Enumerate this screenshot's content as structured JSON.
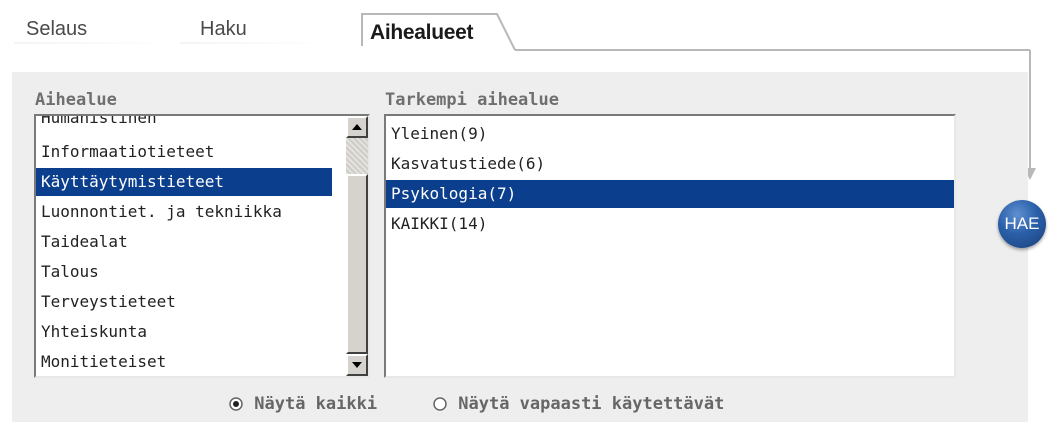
{
  "tabs": [
    {
      "label": "Selaus",
      "active": false
    },
    {
      "label": "Haku",
      "active": false
    },
    {
      "label": "Aihealueet",
      "active": true
    }
  ],
  "left_list": {
    "label": "Aihealue",
    "items": [
      {
        "label": "Humanistinen",
        "selected": false
      },
      {
        "label": "Informaatiotieteet",
        "selected": false
      },
      {
        "label": "Käyttäytymistieteet",
        "selected": true
      },
      {
        "label": "Luonnontiet. ja tekniikka",
        "selected": false
      },
      {
        "label": "Taidealat",
        "selected": false
      },
      {
        "label": "Talous",
        "selected": false
      },
      {
        "label": "Terveystieteet",
        "selected": false
      },
      {
        "label": "Yhteiskunta",
        "selected": false
      },
      {
        "label": "Monitieteiset",
        "selected": false
      }
    ]
  },
  "right_list": {
    "label": "Tarkempi aihealue",
    "items": [
      {
        "label": "Yleinen(9)",
        "selected": false
      },
      {
        "label": "Kasvatustiede(6)",
        "selected": false
      },
      {
        "label": "Psykologia(7)",
        "selected": true
      },
      {
        "label": "KAIKKI(14)",
        "selected": false
      }
    ]
  },
  "radios": [
    {
      "label": "Näytä kaikki",
      "checked": true
    },
    {
      "label": "Näytä vapaasti käytettävät",
      "checked": false
    }
  ],
  "search_button": {
    "label": "HAE"
  },
  "colors": {
    "selection": "#0b3e8c",
    "panel": "#eeeeee",
    "button": "#2a5fa8"
  }
}
